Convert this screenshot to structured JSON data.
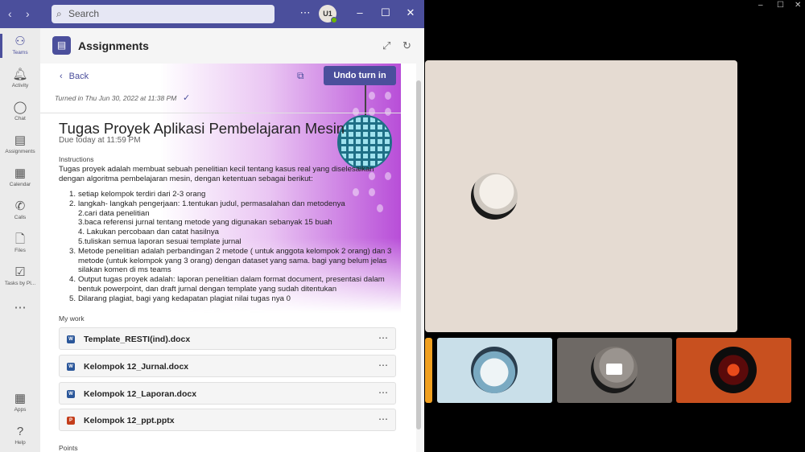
{
  "titlebar": {
    "search_placeholder": "Search",
    "avatar_initials": "U1"
  },
  "rail": [
    {
      "icon": "teams-icon",
      "label": "Teams"
    },
    {
      "icon": "bell-icon",
      "label": "Activity"
    },
    {
      "icon": "chat-icon",
      "label": "Chat"
    },
    {
      "icon": "assignments-icon",
      "label": "Assignments"
    },
    {
      "icon": "calendar-icon",
      "label": "Calendar"
    },
    {
      "icon": "phone-icon",
      "label": "Calls"
    },
    {
      "icon": "file-icon",
      "label": "Files"
    },
    {
      "icon": "tasks-icon",
      "label": "Tasks by Pl..."
    },
    {
      "icon": "more-icon",
      "label": ""
    },
    {
      "icon": "apps-icon",
      "label": "Apps"
    },
    {
      "icon": "help-icon",
      "label": "Help"
    }
  ],
  "app": {
    "title": "Assignments"
  },
  "assignment": {
    "back_label": "Back",
    "undo_label": "Undo turn in",
    "turned_in": "Turned in Thu Jun 30, 2022 at 11:38 PM",
    "title": "Tugas Proyek Aplikasi Pembelajaran Mesin",
    "due": "Due today at 11:59 PM",
    "instructions_label": "Instructions",
    "instructions_intro": "Tugas proyek adalah membuat sebuah penelitian kecil tentang kasus real yang diselesaikan dengan algoritma pembelajaran mesin, dengan ketentuan sebagai berikut:",
    "list": [
      {
        "num": "1.",
        "text": "setiap kelompok terdiri dari 2-3 orang"
      },
      {
        "num": "2.",
        "text": " langkah- langkah pengerjaan: 1.tentukan judul, permasalahan dan metodenya"
      },
      {
        "num": "",
        "text": "2.cari data penelitian"
      },
      {
        "num": "",
        "text": "3.baca referensi  jurnal tentang metode yang digunakan sebanyak 15 buah"
      },
      {
        "num": "",
        "text": "4. Lakukan percobaan dan catat hasilnya"
      },
      {
        "num": "",
        "text": "5.tuliskan semua laporan sesuai template jurnal"
      },
      {
        "num": "3.",
        "text": "Metode penelitian adalah perbandingan 2 metode ( untuk anggota kelompok 2 orang) dan 3 metode (untuk kelompok yang 3 orang) dengan dataset yang sama. bagi yang belum jelas silakan komen di ms teams"
      },
      {
        "num": "4.",
        "text": "Output tugas proyek adalah: laporan penelitian dalam format document, presentasi dalam bentuk powerpoint, dan draft jurnal dengan template yang sudah ditentukan"
      },
      {
        "num": "5.",
        "text": "Dilarang plagiat, bagi yang kedapatan plagiat nilai tugas nya 0"
      }
    ],
    "my_work_label": "My work",
    "files": [
      {
        "name": "Template_RESTI(ind).docx",
        "type": "word",
        "color": "#2b579a",
        "letter": "W"
      },
      {
        "name": "Kelompok 12_Jurnal.docx",
        "type": "word",
        "color": "#2b579a",
        "letter": "W"
      },
      {
        "name": "Kelompok 12_Laporan.docx",
        "type": "word",
        "color": "#2b579a",
        "letter": "W"
      },
      {
        "name": "Kelompok 12_ppt.pptx",
        "type": "powerpoint",
        "color": "#c43e1c",
        "letter": "P"
      }
    ],
    "points_label": "Points"
  },
  "colors": {
    "accent": "#4b4f9c",
    "call_bg": "#000000",
    "stage": "#e5dbd2",
    "tile_orange": "#c8501f",
    "tile_blue": "#c9dfe9",
    "tile_gray": "#6e6965"
  }
}
